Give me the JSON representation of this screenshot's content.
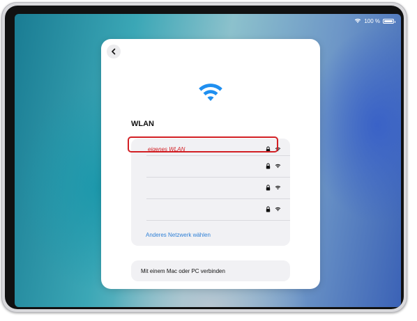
{
  "status_bar": {
    "battery_text": "100 %",
    "icons": [
      "wifi-icon",
      "battery-icon"
    ]
  },
  "sheet": {
    "back_icon": "chevron-left-icon",
    "hero_icon": "wifi-icon",
    "title": "WLAN",
    "networks": [
      {
        "name": "eigenes WLAN",
        "secured": true,
        "selected": true
      },
      {
        "name": "",
        "secured": true,
        "selected": false
      },
      {
        "name": "",
        "secured": true,
        "selected": false
      },
      {
        "name": "",
        "secured": true,
        "selected": false
      }
    ],
    "other_network_label": "Anderes Netzwerk wählen",
    "connect_mac_label": "Mit einem Mac oder PC verbinden"
  },
  "colors": {
    "accent_blue": "#2d7fd6",
    "highlight_red": "#d21f24",
    "sheet_bg": "#ffffff",
    "list_bg": "#f1f1f4"
  }
}
